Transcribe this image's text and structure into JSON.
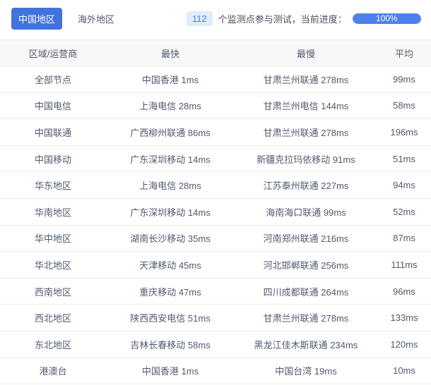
{
  "tabs": [
    {
      "label": "中国地区",
      "active": true
    },
    {
      "label": "海外地区",
      "active": false
    }
  ],
  "monitor": {
    "count": "112",
    "label": "个监测点参与测试，当前进度：",
    "progress_percent": 100,
    "progress_text": "100%"
  },
  "table": {
    "headers": [
      "区域/运营商",
      "最快",
      "最慢",
      "平均"
    ],
    "rows": [
      [
        "全部节点",
        "中国香港 1ms",
        "甘肃兰州联通 278ms",
        "99ms"
      ],
      [
        "中国电信",
        "上海电信 28ms",
        "甘肃兰州电信 144ms",
        "58ms"
      ],
      [
        "中国联通",
        "广西柳州联通 86ms",
        "甘肃兰州联通 278ms",
        "196ms"
      ],
      [
        "中国移动",
        "广东深圳移动 14ms",
        "新疆克拉玛依移动 91ms",
        "51ms"
      ],
      [
        "华东地区",
        "上海电信 28ms",
        "江苏泰州联通 227ms",
        "94ms"
      ],
      [
        "华南地区",
        "广东深圳移动 14ms",
        "海南海口联通 99ms",
        "52ms"
      ],
      [
        "华中地区",
        "湖南长沙移动 35ms",
        "河南郑州联通 216ms",
        "87ms"
      ],
      [
        "华北地区",
        "天津移动 45ms",
        "河北邯郸联通 256ms",
        "111ms"
      ],
      [
        "西南地区",
        "重庆移动 47ms",
        "四川成都联通 264ms",
        "96ms"
      ],
      [
        "西北地区",
        "陕西西安电信 51ms",
        "甘肃兰州联通 278ms",
        "133ms"
      ],
      [
        "东北地区",
        "吉林长春移动 58ms",
        "黑龙江佳木斯联通 234ms",
        "120ms"
      ],
      [
        "港澳台",
        "中国香港 1ms",
        "中国台湾 19ms",
        "10ms"
      ]
    ]
  },
  "colors": {
    "active_tab_blue": "#4272dd",
    "progress_blue": "#4d82ec",
    "badge_bg": "#e1ecfb",
    "badge_text": "#4a7fe8",
    "header_bg": "#f8f8f9",
    "row_border": "#ededef",
    "text": "#515a6e"
  }
}
